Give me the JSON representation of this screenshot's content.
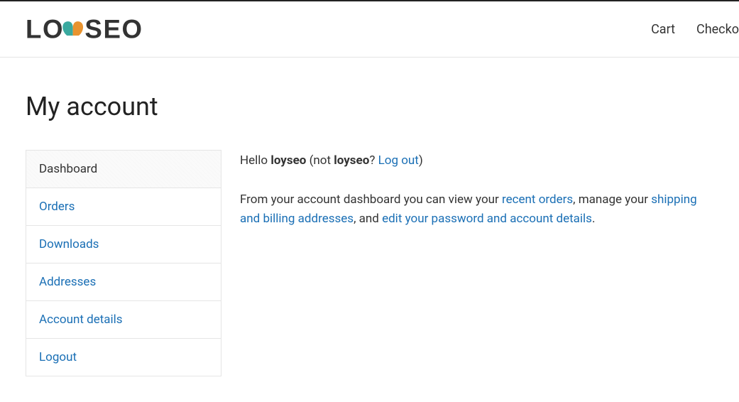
{
  "header": {
    "logo_text": "LOYSEO",
    "nav": {
      "cart": "Cart",
      "checkout": "Checko"
    }
  },
  "page": {
    "title": "My account"
  },
  "sidebar": {
    "items": [
      {
        "label": "Dashboard",
        "active": true
      },
      {
        "label": "Orders",
        "active": false
      },
      {
        "label": "Downloads",
        "active": false
      },
      {
        "label": "Addresses",
        "active": false
      },
      {
        "label": "Account details",
        "active": false
      },
      {
        "label": "Logout",
        "active": false
      }
    ]
  },
  "dashboard": {
    "greeting_prefix": "Hello ",
    "username": "loyseo",
    "not_prefix": " (not ",
    "not_username": "loyseo",
    "not_suffix": "? ",
    "logout_link": "Log out",
    "close_paren": ")",
    "p2_part1": "From your account dashboard you can view your ",
    "recent_orders": "recent orders",
    "p2_part2": ", manage your ",
    "addresses_link": "shipping and billing addresses",
    "p2_part3": ", and ",
    "edit_link": "edit your password and account details",
    "p2_part4": "."
  }
}
